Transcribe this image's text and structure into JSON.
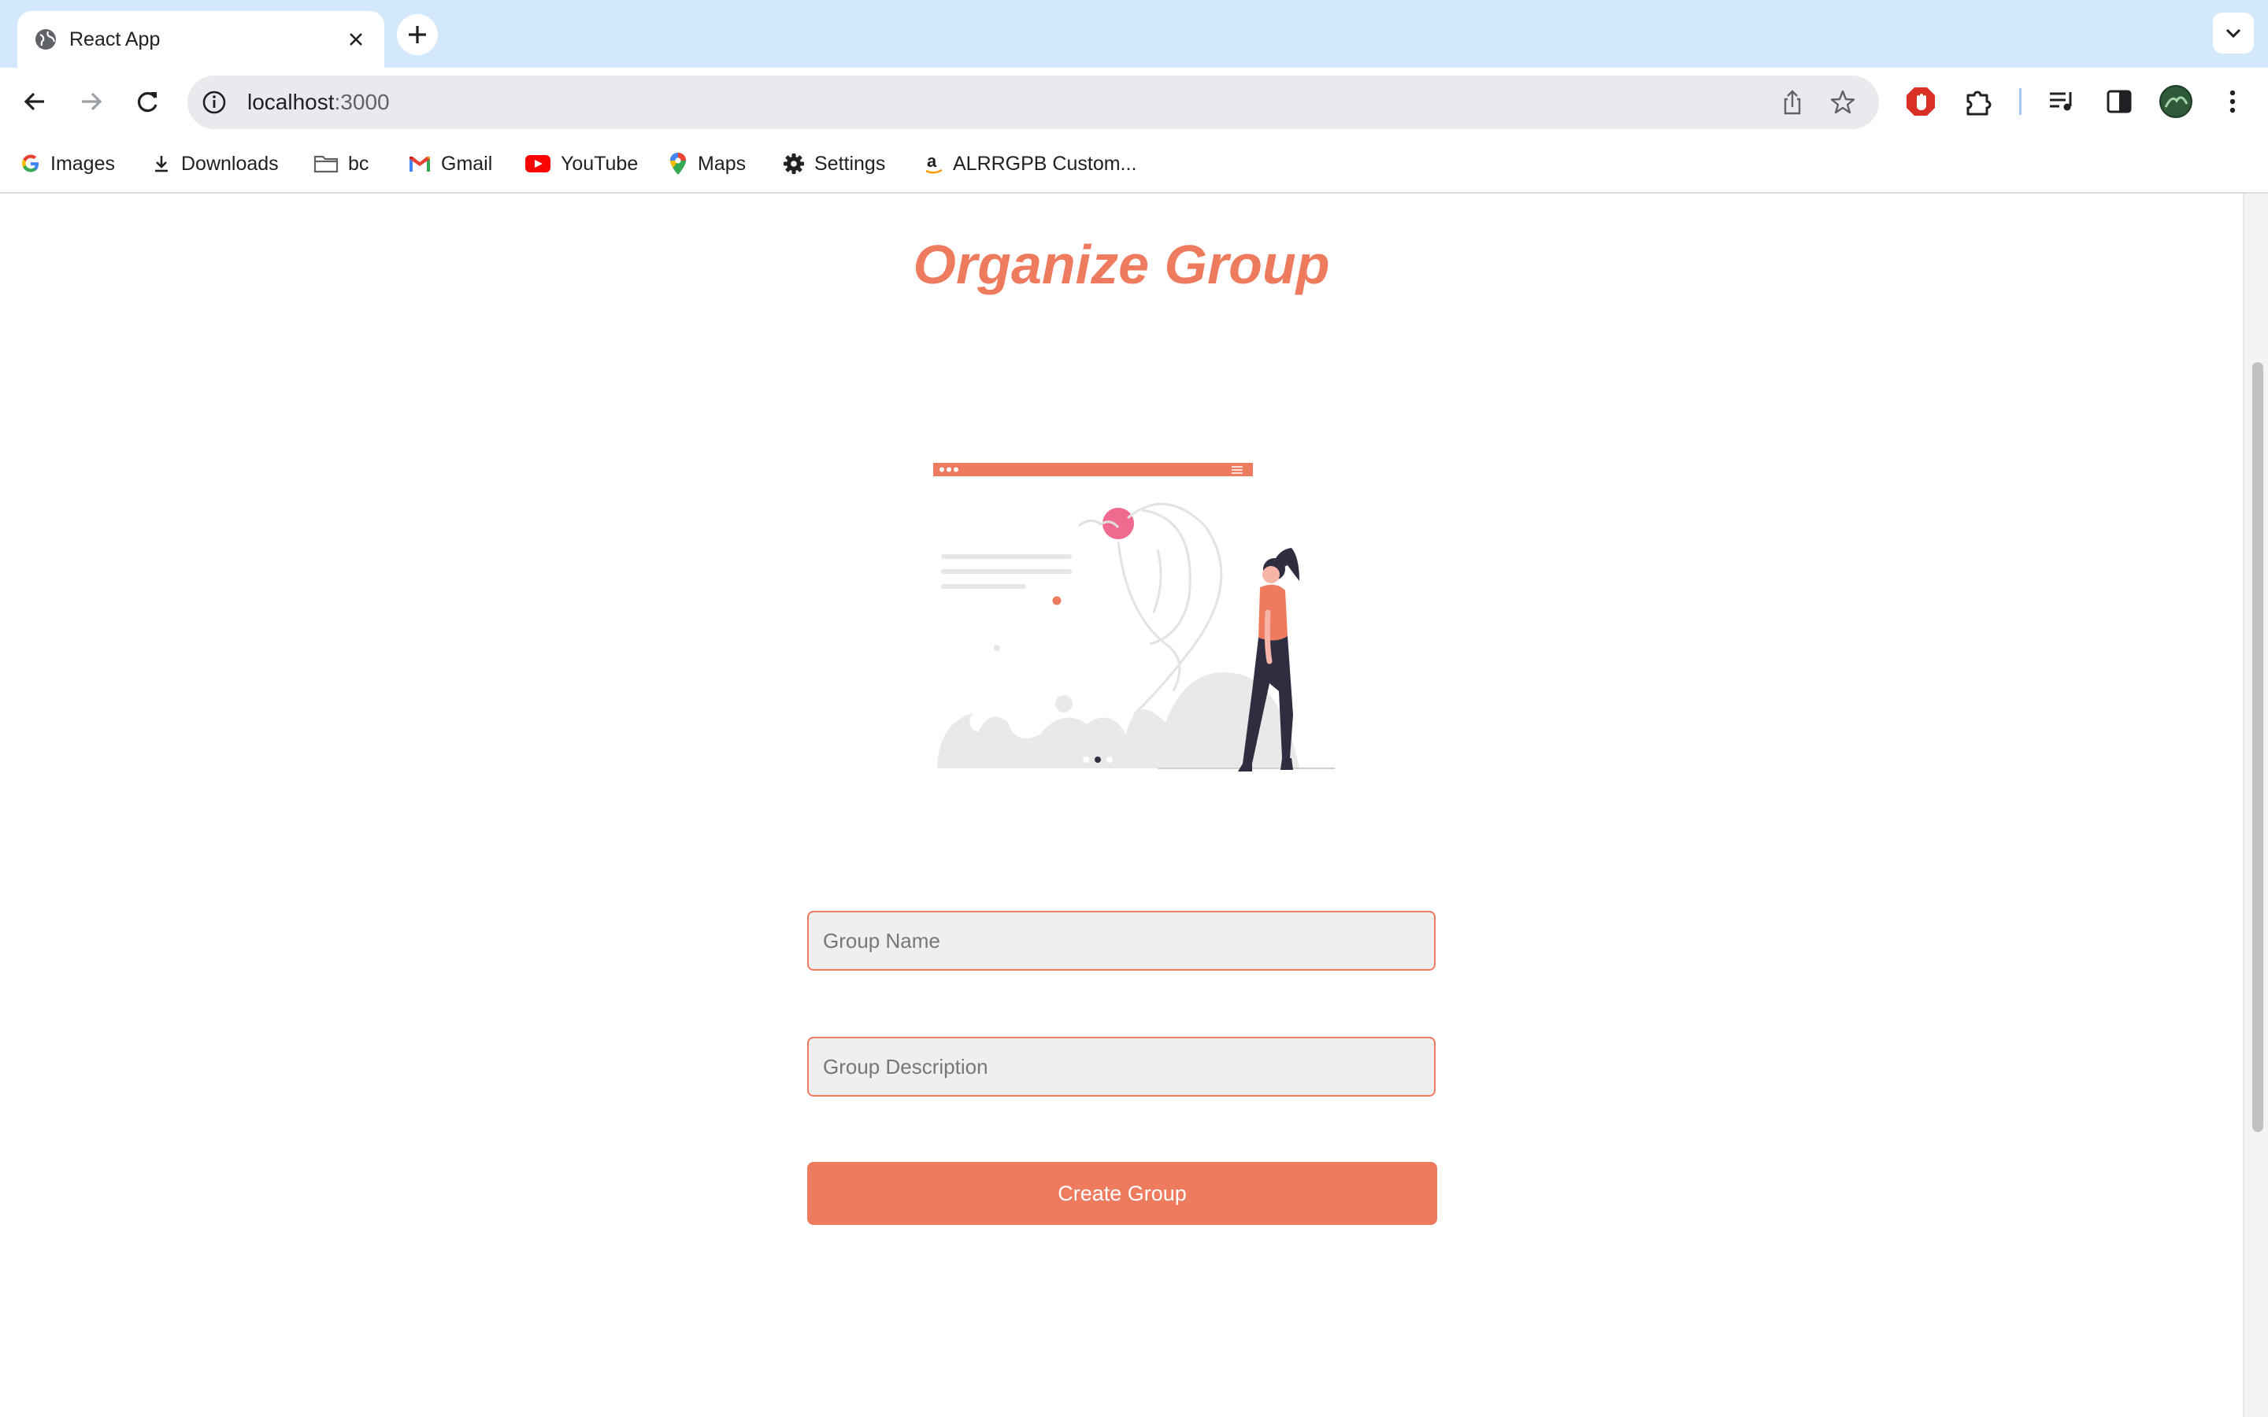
{
  "browser": {
    "tab_title": "React App",
    "url_host": "localhost",
    "url_port": ":3000",
    "bookmarks": [
      {
        "label": "Images",
        "icon": "google-icon"
      },
      {
        "label": "Downloads",
        "icon": "download-icon"
      },
      {
        "label": "bc",
        "icon": "folder-icon"
      },
      {
        "label": "Gmail",
        "icon": "gmail-icon"
      },
      {
        "label": "YouTube",
        "icon": "youtube-icon"
      },
      {
        "label": "Maps",
        "icon": "maps-icon"
      },
      {
        "label": "Settings",
        "icon": "gear-icon"
      },
      {
        "label": "ALRRGPB Custom...",
        "icon": "amazon-icon"
      }
    ]
  },
  "page": {
    "title": "Organize Group",
    "group_name_placeholder": "Group Name",
    "group_description_placeholder": "Group Description",
    "create_button_label": "Create Group"
  },
  "colors": {
    "accent": "#ef7b5f",
    "chrome_tabstrip": "#d3e8fb",
    "field_background": "#efefef"
  }
}
